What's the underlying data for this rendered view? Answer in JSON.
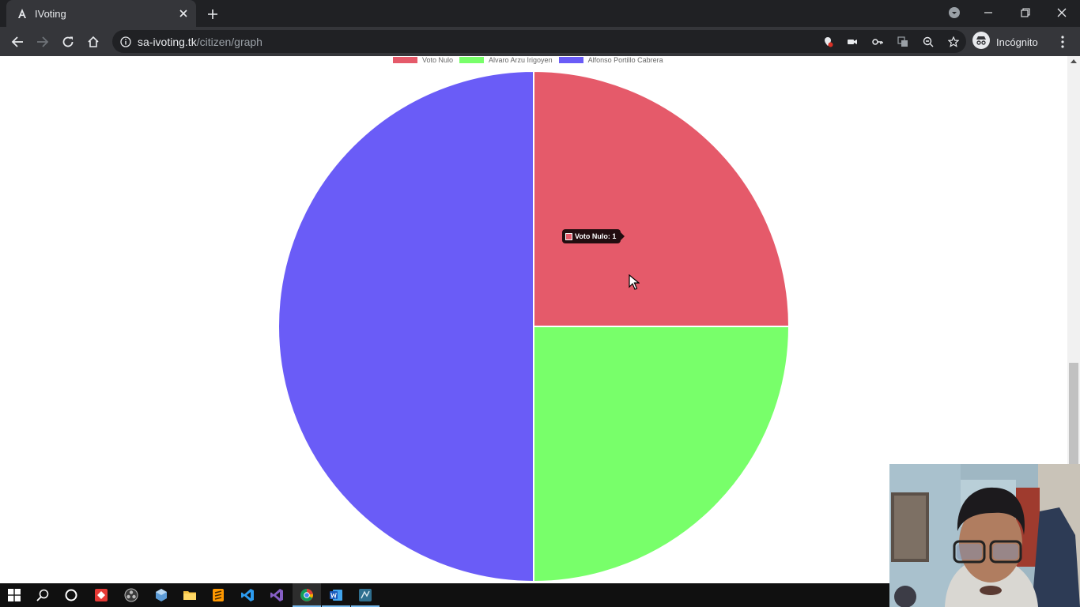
{
  "browser": {
    "tab": {
      "title": "IVoting",
      "favicon_letter": "A"
    },
    "url": {
      "host": "sa-ivoting.tk",
      "path": "/citizen/graph"
    },
    "profile_label": "Incógnito"
  },
  "chart_data": {
    "type": "pie",
    "categories": [
      "Voto Nulo",
      "Alvaro Arzu Irigoyen",
      "Alfonso Portillo Cabrera"
    ],
    "values": [
      1,
      1,
      2
    ],
    "colors": [
      "#e55a6a",
      "#78ff6a",
      "#6a5cf7"
    ],
    "legend_position": "top"
  },
  "tooltip": {
    "label": "Voto Nulo: 1",
    "color": "#e55a6a"
  },
  "taskbar": {
    "apps": [
      "start-icon",
      "search-icon",
      "cortana-icon",
      "anydesk-icon",
      "obs-icon",
      "virtualbox-icon",
      "file-explorer-icon",
      "sublime-text-icon",
      "vscode-icon",
      "visual-studio-icon",
      "chrome-icon",
      "word-icon",
      "mysql-workbench-icon"
    ]
  }
}
